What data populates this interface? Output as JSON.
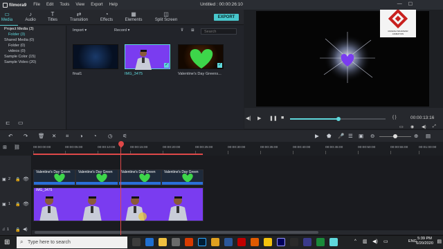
{
  "app": {
    "logo_text": "filmora9",
    "menu": [
      "File",
      "Edit",
      "Tools",
      "View",
      "Export",
      "Help"
    ],
    "title": "Untitled : 00:00:26:10"
  },
  "toolbar": {
    "tabs": [
      {
        "label": "Media",
        "icon": "folder-icon",
        "active": true
      },
      {
        "label": "Audio",
        "icon": "music-note-icon",
        "active": false
      },
      {
        "label": "Titles",
        "icon": "text-T-icon",
        "active": false
      },
      {
        "label": "Transition",
        "icon": "transition-icon",
        "active": false
      },
      {
        "label": "Effects",
        "icon": "effects-icon",
        "active": false
      }
    ],
    "elements_label": "Elements",
    "split_label": "Split Screen",
    "export_label": "EXPORT"
  },
  "sidebar": {
    "items": [
      "Project Media (3)",
      "Folder (3)",
      "Shared Media (0)",
      "Folder (0)",
      "videos (0)",
      "Sample Color (15)",
      "Sample Video (20)"
    ]
  },
  "media": {
    "import_label": "Import",
    "record_label": "Record",
    "search_placeholder": "Search",
    "items": [
      {
        "name": "final1",
        "selected": false
      },
      {
        "name": "IMG_3475",
        "selected": true
      },
      {
        "name": "Valentine's Day Greens...",
        "selected": false
      }
    ]
  },
  "watermark": {
    "lines": [
      "RAKESH SIKARWAR",
      "ANIMATION"
    ]
  },
  "preview": {
    "braces": "{ }",
    "timecode": "00:00:13:16",
    "progress": 0.51
  },
  "timeline": {
    "ruler": [
      "00:00:00:00",
      "00:00:05:00",
      "00:00:10:00",
      "00:00:15:00",
      "00:00:20:00",
      "00:00:25:00",
      "00:00:30:00",
      "00:00:35:00",
      "00:00:40:00",
      "00:00:45:00",
      "00:00:50:00",
      "00:00:55:00",
      "00:01:00:00"
    ],
    "track2_number": "2",
    "track1_number": "1",
    "audio_number": "1",
    "clip_green": "Valentine's Day Green",
    "clip_img": "IMG_3475"
  },
  "taskbar": {
    "search_placeholder": "Type here to search",
    "lang": "ENG",
    "time": "5:39 PM",
    "date": "6/20/2020"
  },
  "colors": {
    "accent": "#5fd8dc",
    "playhead": "#e04848",
    "img_clip": "#7a3cf0",
    "green_clip": "#3dd64a",
    "video_track_bar": "#2a6fd8"
  }
}
